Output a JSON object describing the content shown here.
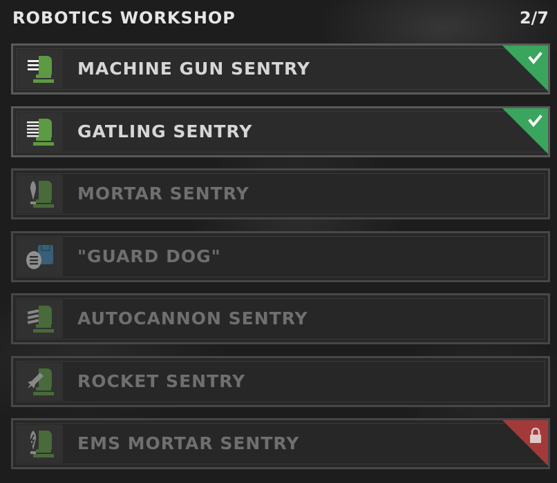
{
  "header": {
    "title": "ROBOTICS WORKSHOP",
    "count": "2/7"
  },
  "colors": {
    "unlocked_badge": "#3aa55c",
    "locked_badge": "#a33a3a",
    "icon_green": "#5e9a43",
    "icon_blue": "#3b7fa8"
  },
  "items": [
    {
      "label": "MACHINE GUN SENTRY",
      "status": "unlocked",
      "icon": "machine-gun-sentry-icon"
    },
    {
      "label": "GATLING SENTRY",
      "status": "unlocked",
      "icon": "gatling-sentry-icon"
    },
    {
      "label": "MORTAR SENTRY",
      "status": "unavailable",
      "icon": "mortar-sentry-icon"
    },
    {
      "label": "\"GUARD DOG\"",
      "status": "unavailable",
      "icon": "guard-dog-icon"
    },
    {
      "label": "AUTOCANNON SENTRY",
      "status": "unavailable",
      "icon": "autocannon-sentry-icon"
    },
    {
      "label": "ROCKET SENTRY",
      "status": "unavailable",
      "icon": "rocket-sentry-icon"
    },
    {
      "label": "EMS MORTAR SENTRY",
      "status": "locked",
      "icon": "ems-mortar-sentry-icon"
    }
  ]
}
